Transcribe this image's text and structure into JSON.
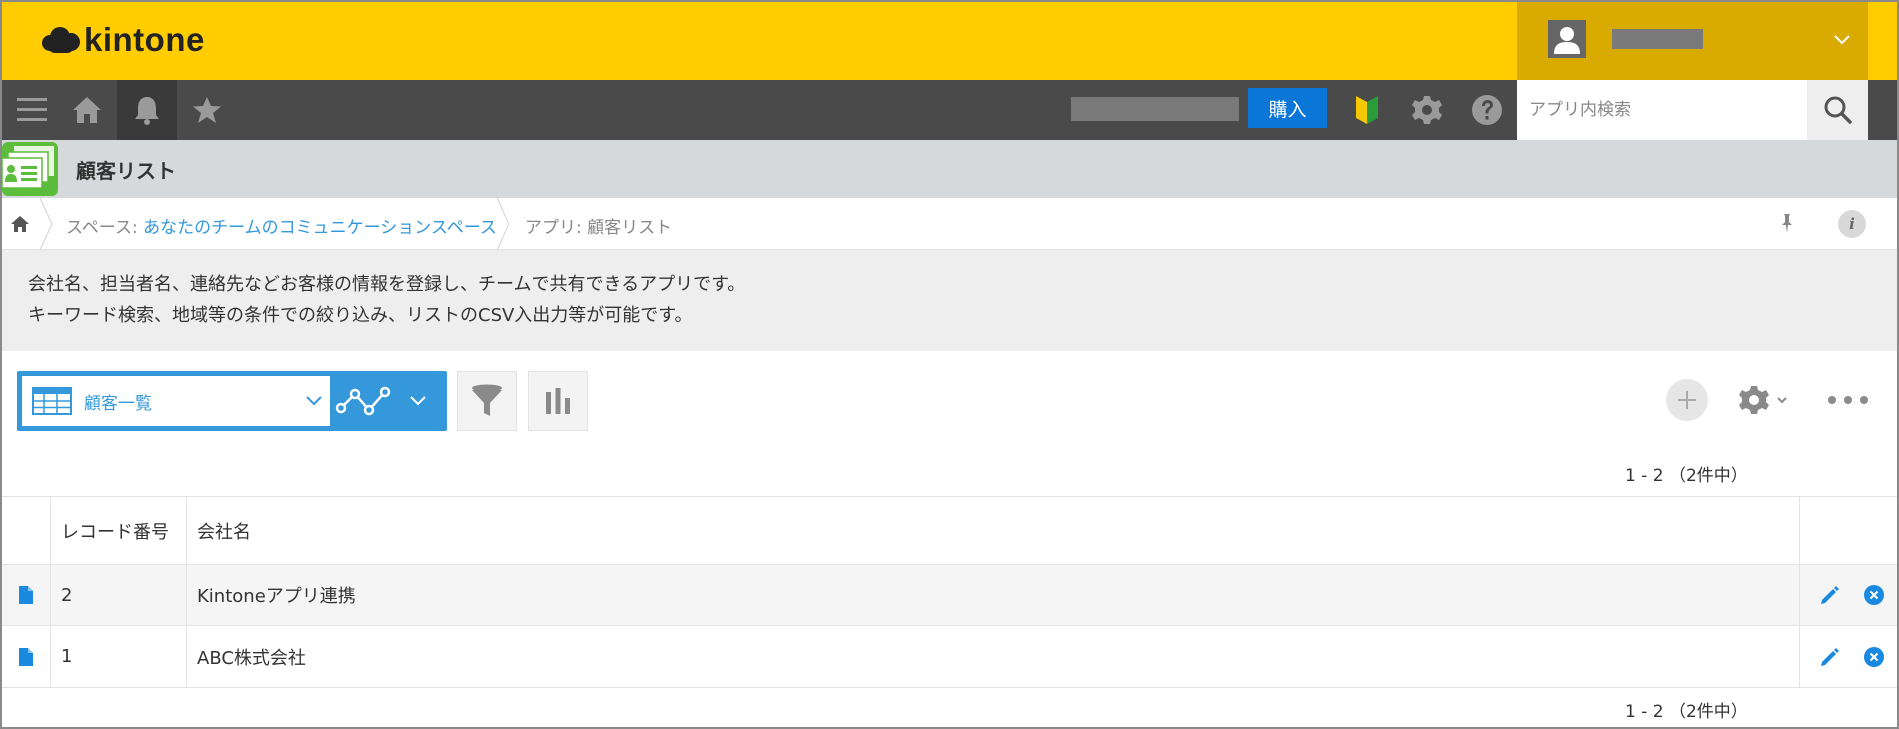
{
  "header": {
    "logo_text": "kintone",
    "brand_color": "#ffcc00"
  },
  "toolbar": {
    "menu_icon": "hamburger-menu-icon",
    "home_icon": "home-icon",
    "notification_icon": "bell-icon",
    "favorite_icon": "star-icon",
    "buy_label": "購入",
    "beginner_icon": "beginner-mark-icon",
    "settings_icon": "gear-icon",
    "help_icon": "help-icon",
    "search_placeholder": "アプリ内検索",
    "search_icon": "search-icon"
  },
  "app": {
    "title": "顧客リスト"
  },
  "breadcrumb": {
    "space_prefix": "スペース: ",
    "space_name": "あなたのチームのコミュニケーションスペース",
    "app_label": "アプリ: 顧客リスト"
  },
  "description": {
    "line1": "会社名、担当者名、連絡先などお客様の情報を登録し、チームで共有できるアプリです。",
    "line2": "キーワード検索、地域等の条件での絞り込み、リストのCSV入出力等が可能です。"
  },
  "view": {
    "selected": "顧客一覧",
    "accent_color": "#3498db"
  },
  "pagination": {
    "top": "1 - 2 （2件中）",
    "bottom": "1 - 2 （2件中）"
  },
  "table": {
    "columns": [
      "レコード番号",
      "会社名"
    ],
    "rows": [
      {
        "record_no": "2",
        "company": "Kintoneアプリ連携"
      },
      {
        "record_no": "1",
        "company": "ABC株式会社"
      }
    ]
  }
}
